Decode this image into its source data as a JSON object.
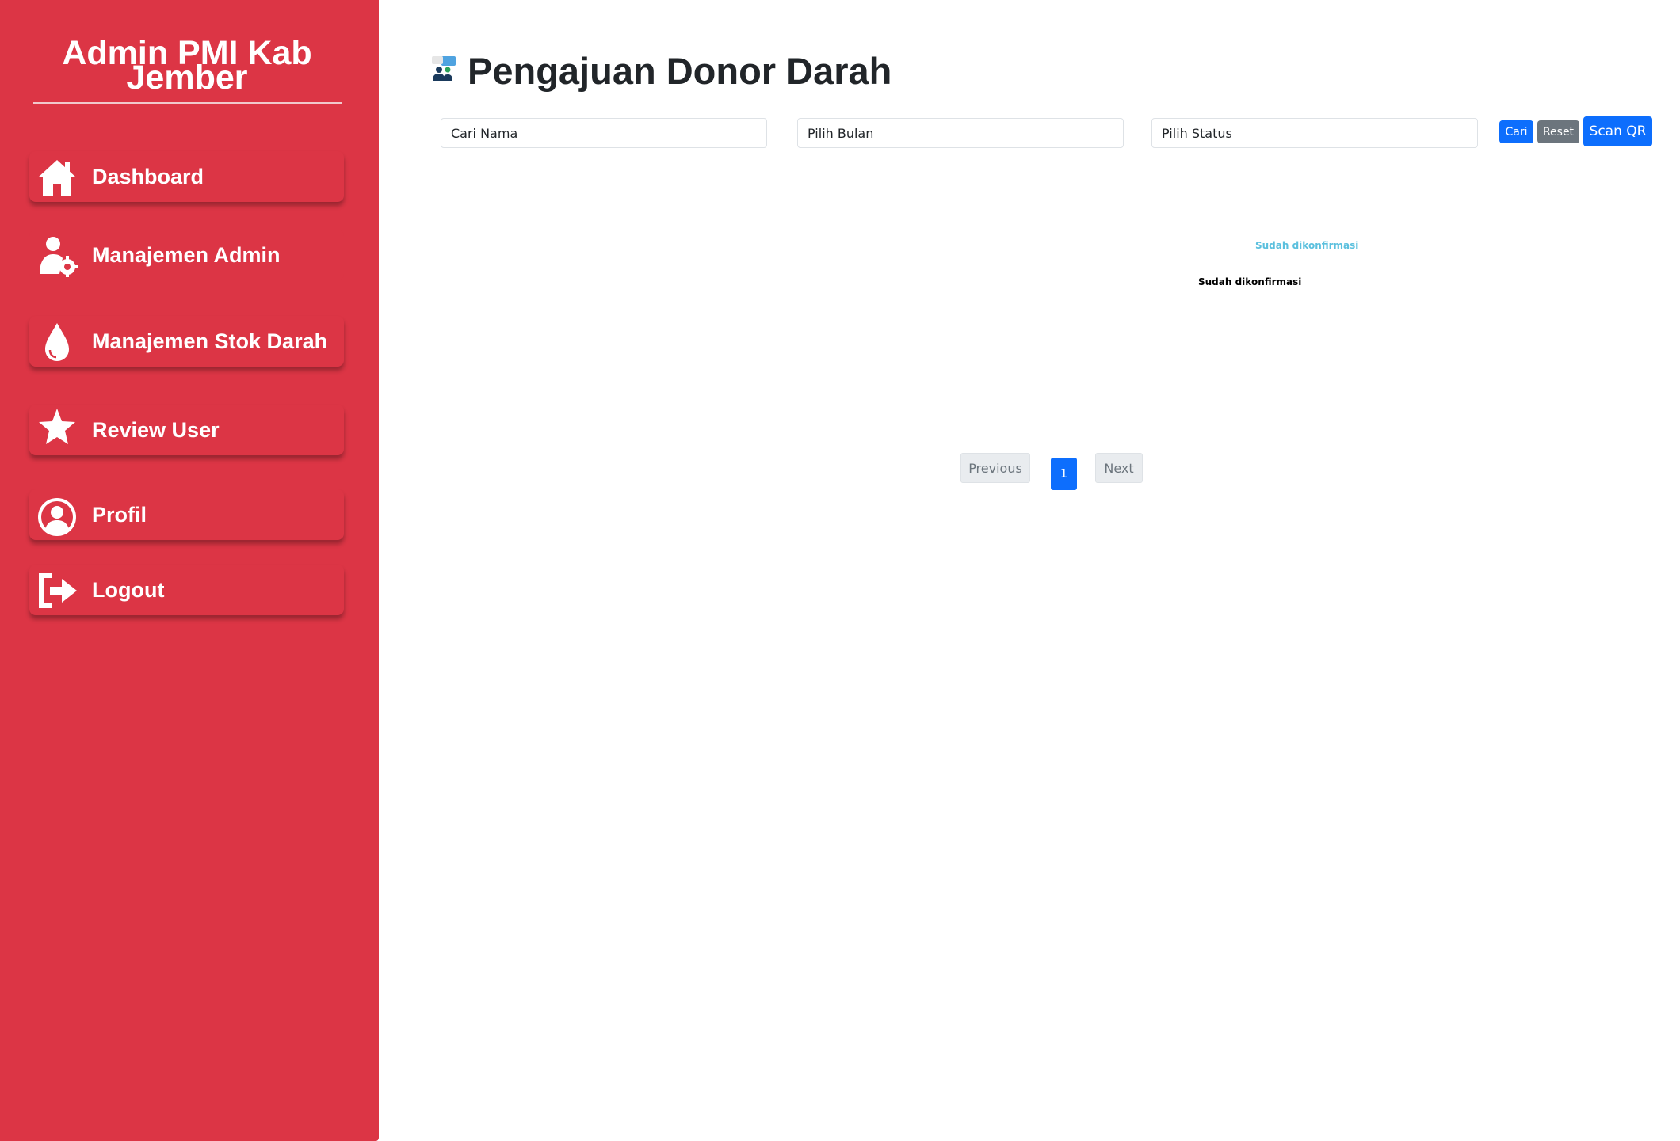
{
  "sidebar": {
    "brand": "Admin PMI Kab Jember",
    "items": [
      {
        "label": "Dashboard",
        "icon": "home-icon"
      },
      {
        "label": "Manajemen Admin",
        "icon": "user-gear-icon"
      },
      {
        "label": "Manajemen Stok Darah",
        "icon": "blood-drop-icon"
      },
      {
        "label": "Review User",
        "icon": "star-icon"
      },
      {
        "label": "Profil",
        "icon": "user-circle-icon"
      },
      {
        "label": "Logout",
        "icon": "logout-icon"
      }
    ]
  },
  "main": {
    "title": "Pengajuan Donor Darah",
    "title_icon": "blood-donor-icon",
    "filters": {
      "name_placeholder": "Cari Nama",
      "month_placeholder": "Pilih Bulan",
      "status_placeholder": "Pilih Status"
    },
    "buttons": {
      "search": "Cari",
      "reset": "Reset",
      "scan_qr": "Scan QR"
    },
    "status_labels": [
      "Sudah dikonfirmasi",
      "Sudah dikonfirmasi"
    ],
    "pagination": {
      "previous": "Previous",
      "current": "1",
      "next": "Next"
    }
  },
  "colors": {
    "sidebar_bg": "#dc3545",
    "primary": "#0d6efd",
    "secondary": "#6c757d",
    "status_info": "#5bc0de"
  }
}
